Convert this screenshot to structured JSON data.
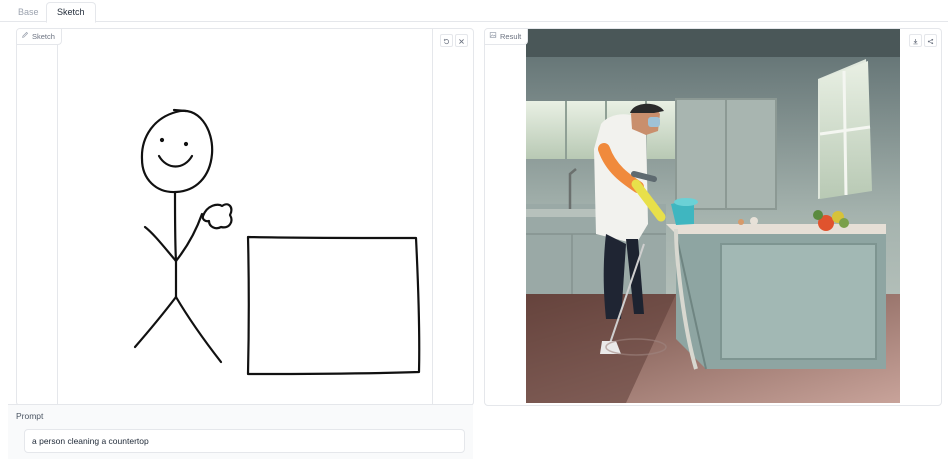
{
  "tabs": [
    {
      "label": "Base",
      "active": false
    },
    {
      "label": "Sketch",
      "active": true
    }
  ],
  "sketch_panel": {
    "label": "Sketch",
    "label_icon": "pencil-icon",
    "undo_icon": "undo-icon",
    "clear_icon": "close-icon"
  },
  "result_panel": {
    "label": "Result",
    "label_icon": "image-icon",
    "download_icon": "download-icon",
    "share_icon": "share-icon"
  },
  "prompt": {
    "label": "Prompt",
    "value": "a person cleaning a countertop"
  },
  "colors": {
    "border": "#e5e7eb",
    "text": "#374151",
    "muted": "#9ca3af"
  }
}
